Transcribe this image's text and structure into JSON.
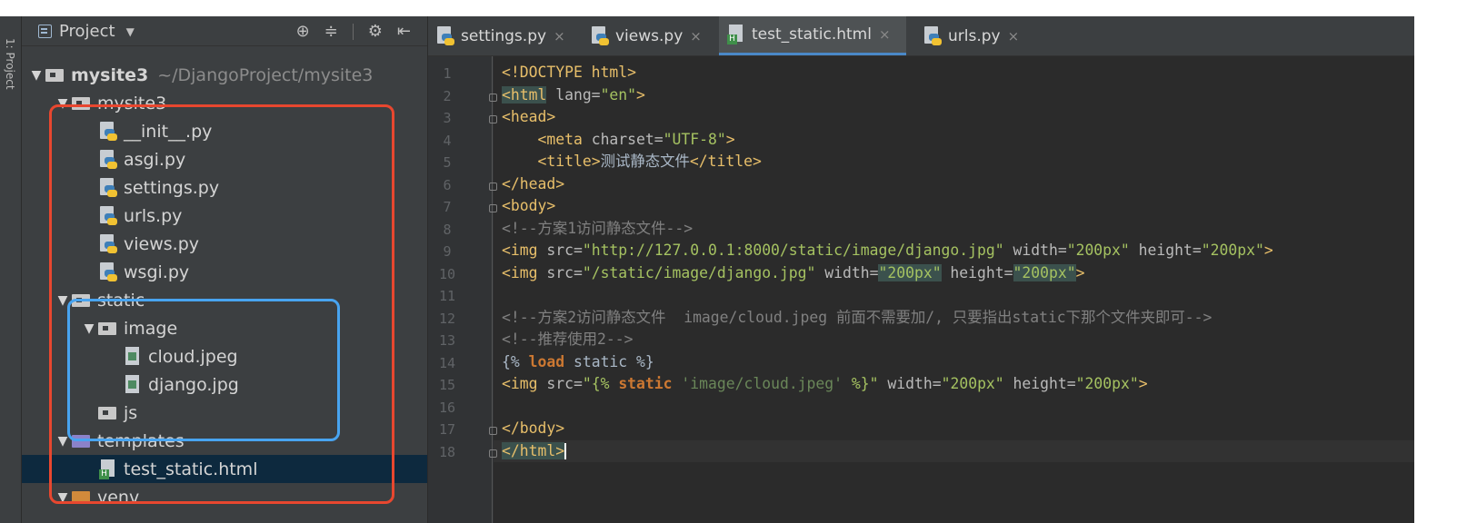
{
  "toolstrip": {
    "label": "1: Project"
  },
  "panel": {
    "title": "Project",
    "tools": [
      "⊕",
      "≑",
      "⚙",
      "⇤"
    ]
  },
  "tree": [
    {
      "label": "mysite3",
      "path": "~/DjangoProject/mysite3",
      "kind": "folder",
      "depth": 0,
      "expanded": true
    },
    {
      "label": "mysite3",
      "kind": "folder",
      "depth": 1,
      "expanded": true
    },
    {
      "label": "__init__.py",
      "kind": "python",
      "depth": 2
    },
    {
      "label": "asgi.py",
      "kind": "python",
      "depth": 2
    },
    {
      "label": "settings.py",
      "kind": "python",
      "depth": 2
    },
    {
      "label": "urls.py",
      "kind": "python",
      "depth": 2
    },
    {
      "label": "views.py",
      "kind": "python",
      "depth": 2
    },
    {
      "label": "wsgi.py",
      "kind": "python",
      "depth": 2
    },
    {
      "label": "static",
      "kind": "folder",
      "depth": 1,
      "expanded": true
    },
    {
      "label": "image",
      "kind": "folder",
      "depth": 2,
      "expanded": true
    },
    {
      "label": "cloud.jpeg",
      "kind": "image",
      "depth": 3
    },
    {
      "label": "django.jpg",
      "kind": "image",
      "depth": 3
    },
    {
      "label": "js",
      "kind": "folder",
      "depth": 2
    },
    {
      "label": "templates",
      "kind": "templates-folder",
      "depth": 1,
      "expanded": true
    },
    {
      "label": "test_static.html",
      "kind": "html",
      "depth": 2,
      "selected": true
    },
    {
      "label": "venv",
      "kind": "venv-folder",
      "depth": 1,
      "expanded": true
    }
  ],
  "tabs": [
    {
      "label": "settings.py",
      "kind": "python",
      "active": false
    },
    {
      "label": "views.py",
      "kind": "python",
      "active": false
    },
    {
      "label": "test_static.html",
      "kind": "html",
      "active": true
    },
    {
      "label": "urls.py",
      "kind": "python",
      "active": false
    }
  ],
  "editor": {
    "line_numbers": [
      "1",
      "2",
      "3",
      "4",
      "5",
      "6",
      "7",
      "8",
      "9",
      "10",
      "11",
      "12",
      "13",
      "14",
      "15",
      "16",
      "17",
      "18"
    ],
    "current_line": 18,
    "lines": [
      [
        {
          "t": "tag",
          "v": "<!DOCTYPE html>"
        }
      ],
      [
        {
          "t": "tag",
          "v": "<html",
          "hl": true
        },
        {
          "t": "attr",
          "v": " lang="
        },
        {
          "t": "val",
          "v": "\"en\""
        },
        {
          "t": "tag",
          "v": ">"
        }
      ],
      [
        {
          "t": "tag",
          "v": "<head>"
        }
      ],
      [
        {
          "t": "txt",
          "v": "    "
        },
        {
          "t": "tag",
          "v": "<meta"
        },
        {
          "t": "attr",
          "v": " charset="
        },
        {
          "t": "val",
          "v": "\"UTF-8\""
        },
        {
          "t": "tag",
          "v": ">"
        }
      ],
      [
        {
          "t": "txt",
          "v": "    "
        },
        {
          "t": "tag",
          "v": "<title>"
        },
        {
          "t": "txt",
          "v": "测试静态文件"
        },
        {
          "t": "tag",
          "v": "</title>"
        }
      ],
      [
        {
          "t": "tag",
          "v": "</head>"
        }
      ],
      [
        {
          "t": "tag",
          "v": "<body>"
        }
      ],
      [
        {
          "t": "com",
          "v": "<!--方案1访问静态文件-->"
        }
      ],
      [
        {
          "t": "tag",
          "v": "<img"
        },
        {
          "t": "attr",
          "v": " src="
        },
        {
          "t": "val",
          "v": "\"http://127.0.0.1:8000/static/image/django.jpg\""
        },
        {
          "t": "attr",
          "v": " width="
        },
        {
          "t": "val",
          "v": "\"200px\""
        },
        {
          "t": "attr",
          "v": " height="
        },
        {
          "t": "val",
          "v": "\"200px\""
        },
        {
          "t": "tag",
          "v": ">"
        }
      ],
      [
        {
          "t": "tag",
          "v": "<img"
        },
        {
          "t": "attr",
          "v": " src="
        },
        {
          "t": "val",
          "v": "\"/static/image/django.jpg\""
        },
        {
          "t": "attr",
          "v": " width="
        },
        {
          "t": "val",
          "v": "\"200px\"",
          "hl": true
        },
        {
          "t": "attr",
          "v": " height="
        },
        {
          "t": "val",
          "v": "\"200px\"",
          "hl": true
        },
        {
          "t": "tag",
          "v": ">"
        }
      ],
      [],
      [
        {
          "t": "com",
          "v": "<!--方案2访问静态文件  image/cloud.jpeg 前面不需要加/, 只要指出static下那个文件夹即可-->"
        }
      ],
      [
        {
          "t": "com",
          "v": "<!--推荐使用2-->"
        }
      ],
      [
        {
          "t": "txt",
          "v": "{% "
        },
        {
          "t": "kw",
          "v": "load"
        },
        {
          "t": "txt",
          "v": " static %}"
        }
      ],
      [
        {
          "t": "tag",
          "v": "<img"
        },
        {
          "t": "attr",
          "v": " src="
        },
        {
          "t": "val",
          "v": "\"{% "
        },
        {
          "t": "kw",
          "v": "static"
        },
        {
          "t": "str",
          "v": " 'image/cloud.jpeg'"
        },
        {
          "t": "val",
          "v": " %}\""
        },
        {
          "t": "attr",
          "v": " width="
        },
        {
          "t": "val",
          "v": "\"200px\""
        },
        {
          "t": "attr",
          "v": " height="
        },
        {
          "t": "val",
          "v": "\"200px\""
        },
        {
          "t": "tag",
          "v": ">"
        }
      ],
      [],
      [
        {
          "t": "tag",
          "v": "</body>"
        }
      ],
      [
        {
          "t": "tag",
          "v": "</html>",
          "hl": true
        }
      ]
    ]
  },
  "colors": {
    "red_box": "#e8472f",
    "blue_box": "#48a4f0",
    "selection": "#0d293e",
    "active_tab_underline": "#4a88c7"
  }
}
